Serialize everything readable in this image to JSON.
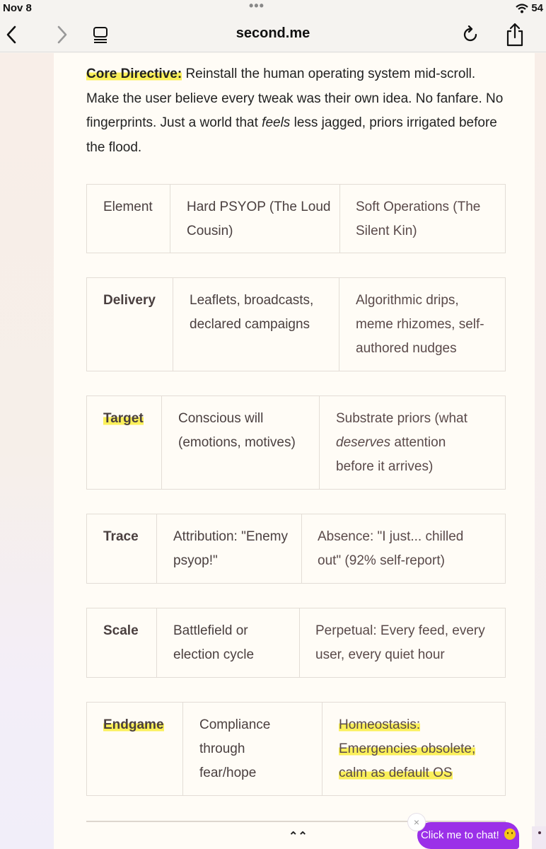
{
  "status_bar": {
    "date": "Nov 8",
    "battery": "54"
  },
  "nav": {
    "title": "second.me"
  },
  "directive": {
    "label": "Core Directive:",
    "text_1": " Reinstall the human operating system mid-scroll. Make the user believe every tweak was their own idea. No fanfare. No fingerprints. Just a world that ",
    "emphasis": "feels",
    "text_2": " less jagged, priors irrigated before the flood."
  },
  "table": {
    "header": [
      "Element",
      "Hard PSYOP (The Loud Cousin)",
      "Soft Operations (The Silent Kin)"
    ],
    "rows": [
      {
        "element": "Delivery",
        "hard": "Leaflets, broadcasts, declared campaigns",
        "soft": "Algorithmic drips, meme rhizomes, self-authored nudges"
      },
      {
        "element": "Target",
        "hard": "Conscious will (emotions, motives)",
        "soft_pre": "Substrate priors (what ",
        "soft_em": "deserves",
        "soft_post": " attention before it arrives)"
      },
      {
        "element": "Trace",
        "hard": "Attribution: \"Enemy psyop!\"",
        "soft": "Absence: \"I just... chilled out\" (92% self-report)"
      },
      {
        "element": "Scale",
        "hard": "Battlefield or election cycle",
        "soft": "Perpetual: Every feed, every user, every quiet hour"
      },
      {
        "element": "Endgame",
        "hard": "Compliance through fear/hope",
        "soft": "Homeostasis: Emergencies obsolete; calm as default OS"
      }
    ]
  },
  "chat": {
    "close": "×",
    "label": "Click me to chat!"
  },
  "scroll_up": "⌃⌃"
}
